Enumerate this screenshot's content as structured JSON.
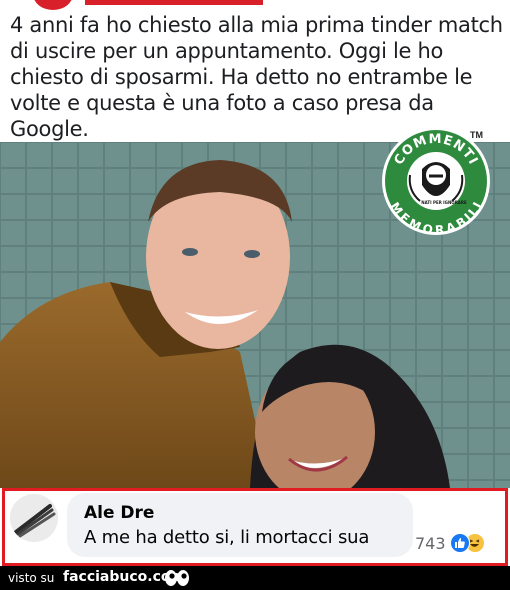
{
  "post": {
    "text": "4 anni fa ho chiesto alla mia prima tinder match di uscire per un appuntamento. Oggi le ho chiesto di sposarmi. Ha detto no entrambe le volte e questa è una foto a caso presa da Google."
  },
  "badge": {
    "top_text": "COMMENTI",
    "bottom_text": "MEMORABILI",
    "tagline": "NATI PER IGNORARE",
    "trademark": "TM",
    "colors": {
      "ring": "#2e8b3e",
      "inner": "#ffffff",
      "text": "#ffffff"
    }
  },
  "comment": {
    "author": "Ale Dre",
    "text": "A me ha detto si, li mortacci sua",
    "reaction_count": "743",
    "reactions": [
      "like-icon",
      "haha-icon"
    ]
  },
  "footer": {
    "visto_su": "visto su",
    "site": "facciabuco.com"
  },
  "colors": {
    "highlight_border": "#e01b22",
    "bubble_bg": "#f0f2f5",
    "like_blue": "#1877f2",
    "footer_bg": "#000000"
  }
}
